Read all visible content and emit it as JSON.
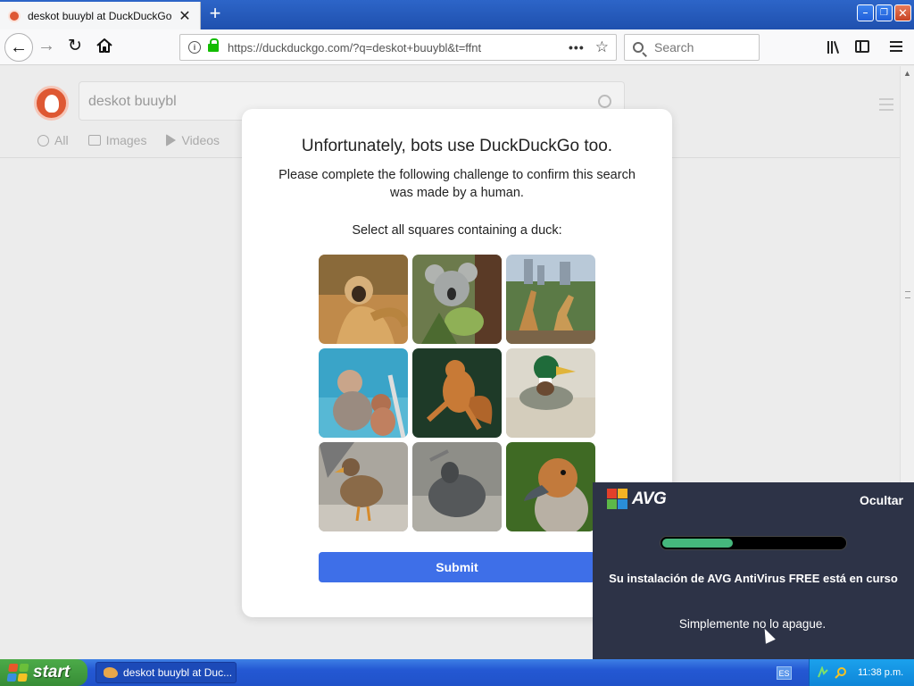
{
  "browser": {
    "tab": {
      "title": "deskot buuybl at DuckDuckGo",
      "close": "✕"
    },
    "new_tab": "+",
    "url": "https://duckduckgo.com/?q=deskot+buuybl&t=ffnt",
    "url_more": "•••",
    "search_placeholder": "Search",
    "window_controls": {
      "minimize": "–",
      "restore": "❐",
      "close": "✕"
    }
  },
  "page": {
    "query": "deskot buuybl",
    "tabs": [
      {
        "label": "All",
        "icon": "search-icon"
      },
      {
        "label": "Images",
        "icon": "image-icon"
      },
      {
        "label": "Videos",
        "icon": "play-icon"
      }
    ]
  },
  "challenge": {
    "title": "Unfortunately, bots use DuckDuckGo too.",
    "subtitle": "Please complete the following challenge to confirm this search was made by a human.",
    "prompt": "Select all squares containing a duck:",
    "tiles": [
      {
        "subject": "gibbon"
      },
      {
        "subject": "koala"
      },
      {
        "subject": "giraffes"
      },
      {
        "subject": "monkeys"
      },
      {
        "subject": "squirrel"
      },
      {
        "subject": "mallard-duck"
      },
      {
        "subject": "female-duck"
      },
      {
        "subject": "sleeping-duck"
      },
      {
        "subject": "whistling-duck"
      }
    ],
    "submit_label": "Submit"
  },
  "avg_popup": {
    "brand": "AVG",
    "hide_label": "Ocultar",
    "progress": 0.4,
    "message": "Su instalación de AVG AntiVirus FREE está en curso",
    "note": "Simplemente no lo apague.",
    "colors": {
      "background": "#2d3347",
      "progress": "#45b87c"
    }
  },
  "taskbar": {
    "start_label": "start",
    "window_item": "deskot buuybl at Duc...",
    "language": "ES",
    "clock": "11:38 p.m."
  }
}
